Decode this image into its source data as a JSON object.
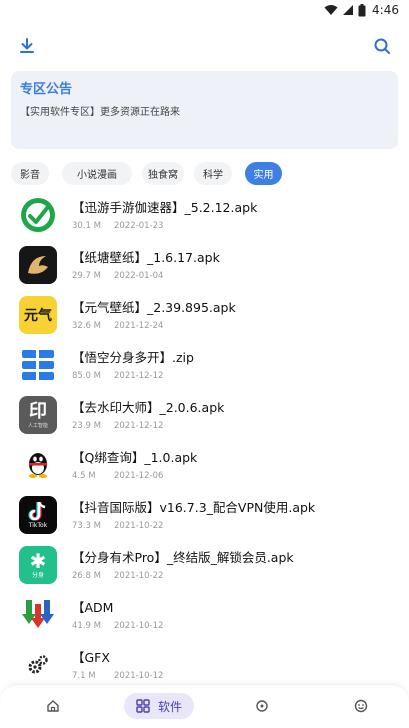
{
  "status": {
    "time": "4:46"
  },
  "notice": {
    "title": "专区公告",
    "body": "【实用软件专区】更多资源正在路来"
  },
  "categories": [
    {
      "label": "影音"
    },
    {
      "label": "小说漫画"
    },
    {
      "label": "独食窝"
    },
    {
      "label": "科学"
    },
    {
      "label": "实用"
    }
  ],
  "apps": [
    {
      "name": "【迅游手游伽速器】_5.2.12.apk",
      "size": "30.1 M",
      "date": "2022-01-23"
    },
    {
      "name": "【纸塘壁纸】_1.6.17.apk",
      "size": "29.7 M",
      "date": "2022-01-04"
    },
    {
      "name": "【元气壁纸】_2.39.895.apk",
      "size": "32.6 M",
      "date": "2021-12-24"
    },
    {
      "name": "【悟空分身多开】.zip",
      "size": "85.0 M",
      "date": "2021-12-12"
    },
    {
      "name": "【去水印大师】_2.0.6.apk",
      "size": "23.9 M",
      "date": "2021-12-12"
    },
    {
      "name": "【Q绑查询】_1.0.apk",
      "size": "4.5 M",
      "date": "2021-12-06"
    },
    {
      "name": "【抖音国际版】v16.7.3_配合VPN使用.apk",
      "size": "73.3 M",
      "date": "2021-10-22"
    },
    {
      "name": "【分身有术Pro】_终结版_解锁会员.apk",
      "size": "26.8 M",
      "date": "2021-10-22"
    },
    {
      "name": "【ADM",
      "size": "41.9 M",
      "date": "2021-10-12"
    },
    {
      "name": "【GFX",
      "size": "7.1 M",
      "date": "2021-10-12"
    }
  ],
  "icon_texts": {
    "yuanqi": "元气",
    "watermark": "印",
    "watermark_sub": "人工智能",
    "tiktok": "TikTok",
    "fenshen": "分身"
  },
  "nav": {
    "software_label": "软件"
  },
  "colors": {
    "accent": "#3f7fe3",
    "nav_active": "#4a3fb0"
  }
}
